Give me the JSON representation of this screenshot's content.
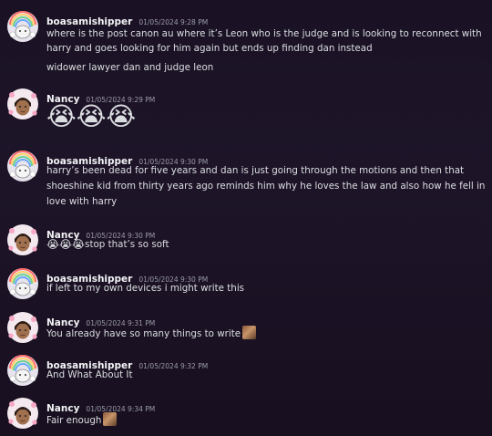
{
  "messages": [
    {
      "author": "boasamishipper",
      "timestamp": "01/05/2024 9:28 PM",
      "lines": [
        "where is the post canon au where it’s Leon who is the judge and is looking to reconnect with",
        "harry and goes looking for him again but ends up finding dan instead",
        "widower lawyer dan and judge leon"
      ]
    },
    {
      "author": "Nancy",
      "timestamp": "01/05/2024 9:29 PM",
      "emoji": "😭😭😭"
    },
    {
      "author": "boasamishipper",
      "timestamp": "01/05/2024 9:30 PM",
      "lines": [
        "harry’s been dead for five years and dan is just going through the motions and then that",
        "shoeshine kid from thirty years ago reminds him why he loves the law and also how he fell in",
        "love with harry"
      ]
    },
    {
      "author": "Nancy",
      "timestamp": "01/05/2024 9:30 PM",
      "emoji": "😭😭😭",
      "text": "stop that’s so soft"
    },
    {
      "author": "boasamishipper",
      "timestamp": "01/05/2024 9:30 PM",
      "text": "if left to my own devices i might write this"
    },
    {
      "author": "Nancy",
      "timestamp": "01/05/2024 9:31 PM",
      "text": "You already have so many things to write"
    },
    {
      "author": "boasamishipper",
      "timestamp": "01/05/2024 9:32 PM",
      "text": "And What About It"
    },
    {
      "author": "Nancy",
      "timestamp": "01/05/2024 9:34 PM",
      "text": "Fair enough"
    }
  ],
  "colors": {
    "background": "#1a1224",
    "name": "#f2f3f5",
    "timestamp": "#9b9ba8",
    "text": "#dbdee1"
  }
}
